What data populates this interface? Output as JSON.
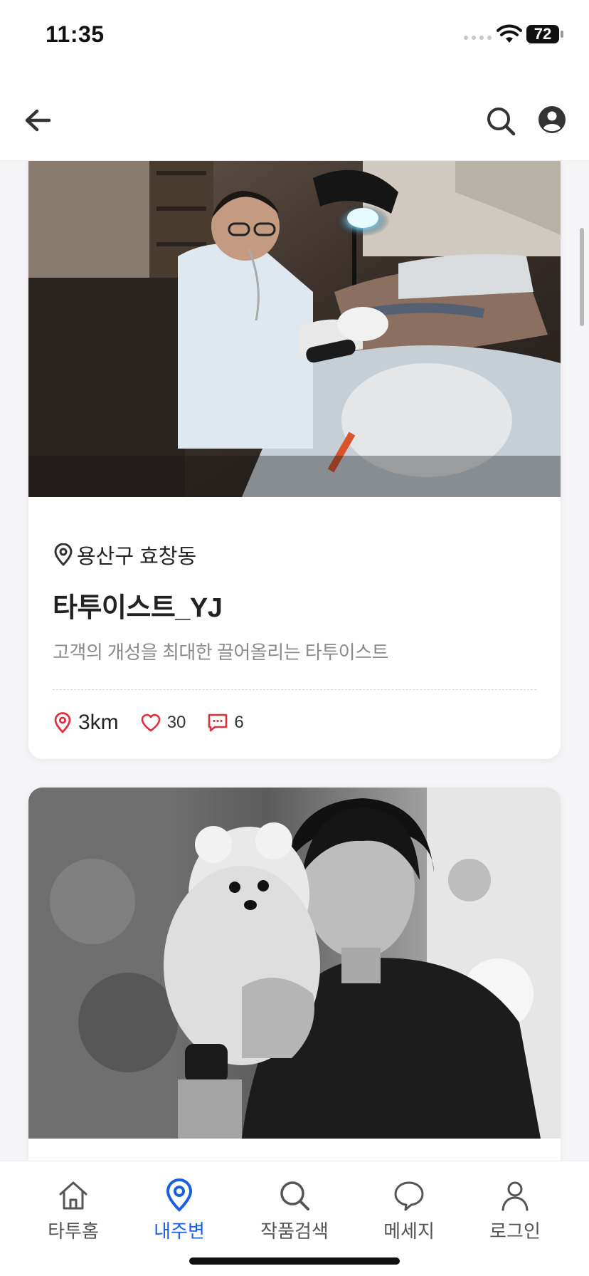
{
  "status_bar": {
    "time": "11:35",
    "battery": "72"
  },
  "colors": {
    "accent": "#1a5fe0",
    "stat_icon": "#e0303c"
  },
  "header": {
    "back_icon": "arrow-left-icon",
    "search_icon": "search-icon",
    "profile_icon": "user-circle-icon"
  },
  "cards": [
    {
      "location": "용산구 효창동",
      "name": "타투이스트_YJ",
      "description": "고객의 개성을 최대한 끌어올리는 타투이스트",
      "distance": "3km",
      "likes": "30",
      "comments": "6"
    }
  ],
  "tab_bar": {
    "items": [
      {
        "label": "타투홈",
        "icon": "home-icon",
        "active": false
      },
      {
        "label": "내주변",
        "icon": "map-pin-icon",
        "active": true
      },
      {
        "label": "작품검색",
        "icon": "search-icon",
        "active": false
      },
      {
        "label": "메세지",
        "icon": "chat-bubble-icon",
        "active": false
      },
      {
        "label": "로그인",
        "icon": "person-icon",
        "active": false
      }
    ]
  }
}
